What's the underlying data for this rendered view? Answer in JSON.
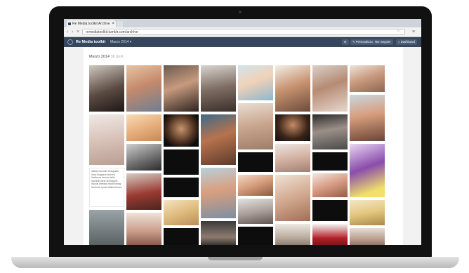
{
  "browser": {
    "tab_title": "Re Media toolkit Archive",
    "url": "remediatoolkit.tumblr.com/archive",
    "back_icon": "back-arrow-icon",
    "forward_icon": "forward-arrow-icon",
    "reload_icon": "reload-icon"
  },
  "header": {
    "blog_name": "Re Media toolkit",
    "month_selector": "Marzo 2014 ▾",
    "buttons": [
      "✉",
      "✎ Personalizza",
      "Non seguire",
      "⌂ Dashboard"
    ]
  },
  "archive": {
    "month_label": "Marzo 2014",
    "post_count": "36 post",
    "text_post": "#italian #tumblr #fotografia #foto #ragazze #donna #bellezza #moda #stile #portrait #arte #immagine #social #media #toolkit #blog #archivio #post #italia #marzo"
  },
  "colors": {
    "tumblr_blue": "#36465d",
    "page_bg": "#f2f2f2",
    "dark_tile": "#0d0d0d"
  }
}
